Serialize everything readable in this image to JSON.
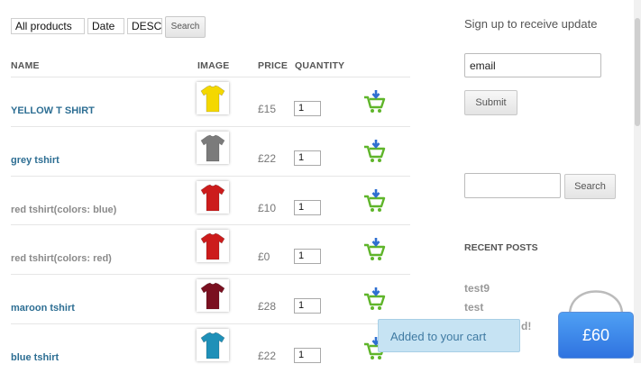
{
  "filters": {
    "category": "All products",
    "sort_by": "Date",
    "order": "DESC",
    "search_button": "Search"
  },
  "table": {
    "headers": [
      "NAME",
      "IMAGE",
      "PRICE",
      "QUANTITY"
    ],
    "rows": [
      {
        "name": "YELLOW T SHIRT",
        "price": "£15",
        "quantity": "1",
        "shirt_color": "#f4d800",
        "name_style": "link"
      },
      {
        "name": "grey tshirt",
        "price": "£22",
        "quantity": "1",
        "shirt_color": "#7b7b7b",
        "name_style": "link"
      },
      {
        "name": "red tshirt(colors: blue)",
        "price": "£10",
        "quantity": "1",
        "shirt_color": "#cc1c1c",
        "name_style": "gray"
      },
      {
        "name": "red tshirt(colors: red)",
        "price": "£0",
        "quantity": "1",
        "shirt_color": "#cc1c1c",
        "name_style": "gray"
      },
      {
        "name": "maroon tshirt",
        "price": "£28",
        "quantity": "1",
        "shirt_color": "#7a1020",
        "name_style": "link"
      },
      {
        "name": "blue tshirt",
        "price": "£22",
        "quantity": "1",
        "shirt_color": "#1f90b8",
        "name_style": "link"
      }
    ]
  },
  "sidebar": {
    "signup_text": "Sign up to receive update",
    "email_value": "email",
    "submit_label": "Submit",
    "search_label": "Search",
    "recent_posts_heading": "RECENT POSTS",
    "posts": [
      "test9",
      "test",
      "d!"
    ]
  },
  "toast": {
    "message": "Added to your cart"
  },
  "cart": {
    "total": "£60"
  },
  "colors": {
    "link": "#2d6e93",
    "toast_bg": "#c6e3f3",
    "cart_blue": "#3b82ea",
    "cart_green": "#6cc02f"
  },
  "icons": {
    "add_to_cart": "add-to-cart-icon",
    "bag": "shopping-bag-icon"
  }
}
